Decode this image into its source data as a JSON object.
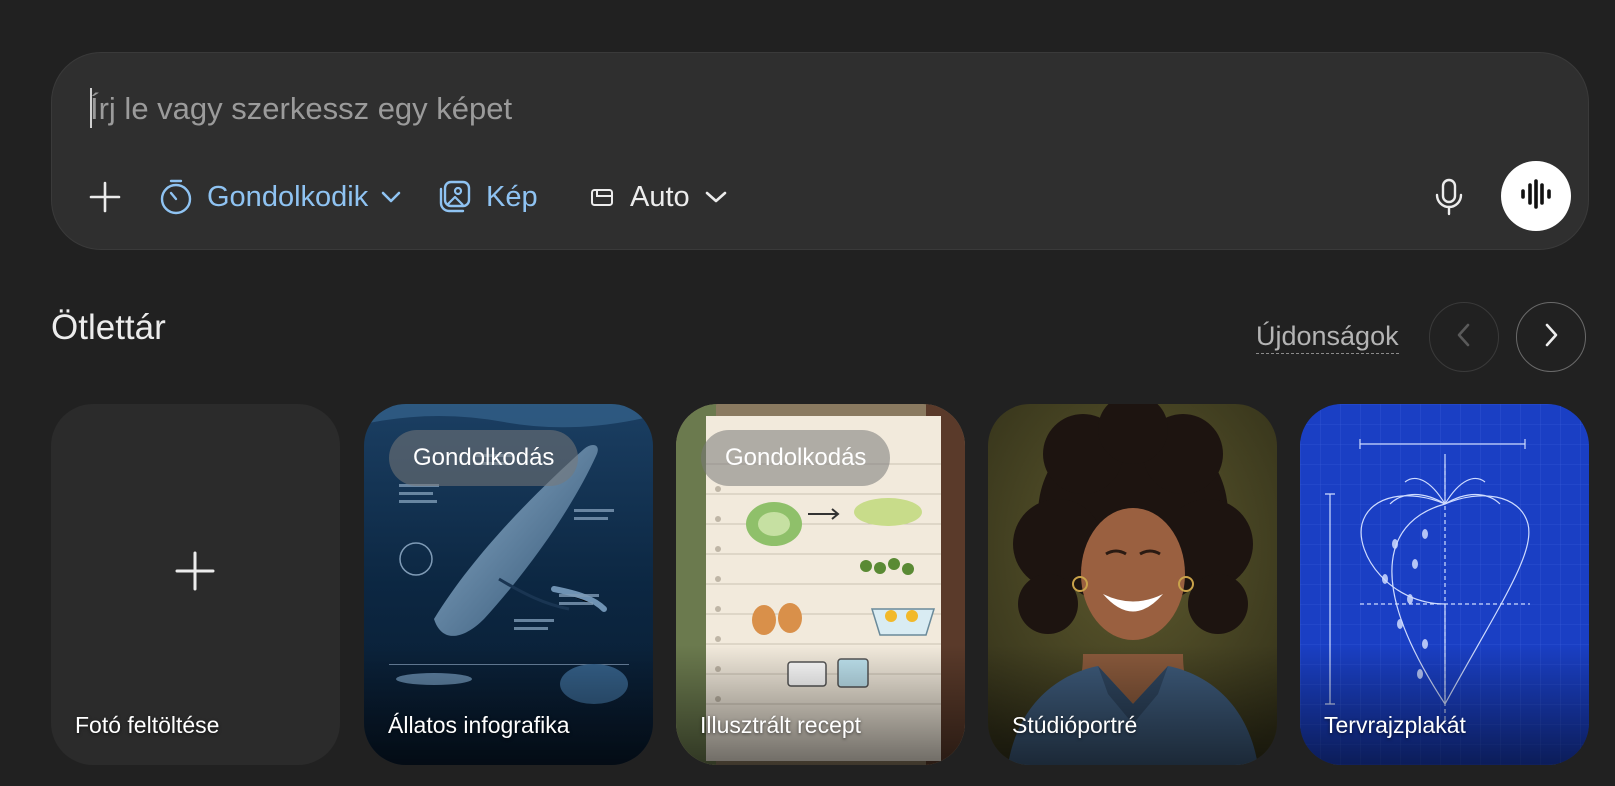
{
  "composer": {
    "placeholder": "Írj le vagy szerkessz egy képet",
    "value": "",
    "tools": {
      "add_icon": "plus-icon",
      "thinking_label": "Gondolkodik",
      "thinking_icon": "stopwatch-icon",
      "image_label": "Kép",
      "image_icon": "image-stack-icon",
      "aspect_label": "Auto",
      "aspect_icon": "aspect-ratio-icon",
      "mic_icon": "microphone-icon",
      "voice_icon": "voice-wave-icon"
    },
    "colors": {
      "accent_blue": "#8fc3f2",
      "background": "#2f2f2f"
    }
  },
  "gallery": {
    "title": "Ötlettár",
    "news_label": "Újdonságok",
    "prev_icon": "chevron-left-icon",
    "next_icon": "chevron-right-icon",
    "cards": [
      {
        "label": "Fotó feltöltése",
        "badge": ""
      },
      {
        "label": "Állatos infografika",
        "badge": "Gondolkodás"
      },
      {
        "label": "Illusztrált recept",
        "badge": "Gondolkodás"
      },
      {
        "label": "Stúdióportré",
        "badge": ""
      },
      {
        "label": "Tervrajzplakát",
        "badge": ""
      }
    ]
  }
}
